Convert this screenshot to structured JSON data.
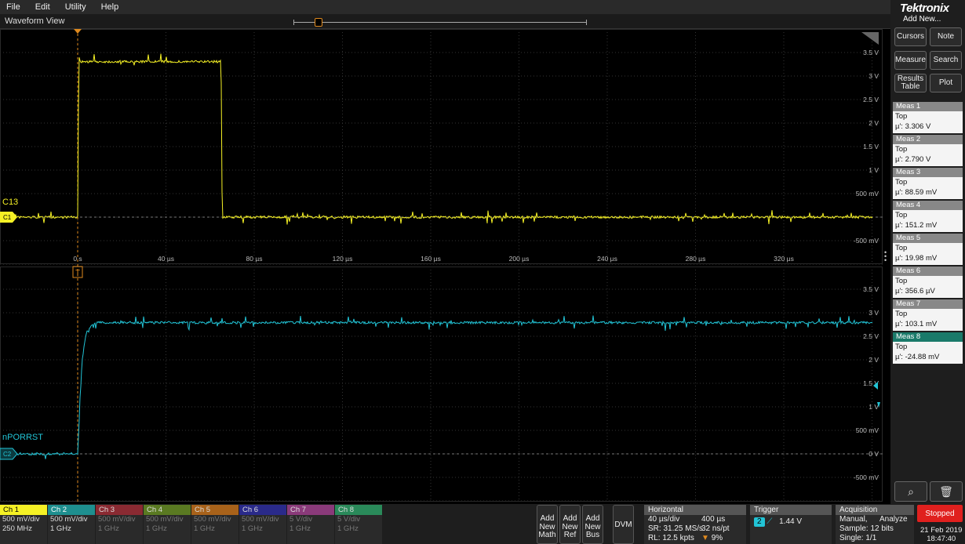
{
  "menu": [
    "File",
    "Edit",
    "Utility",
    "Help"
  ],
  "waveform_view": {
    "title": "Waveform View"
  },
  "sidebar": {
    "brand": "Tektronix",
    "add_new": "Add New...",
    "buttons": {
      "cursors": "Cursors",
      "note": "Note",
      "measure": "Measure",
      "search": "Search",
      "results_table": "Results Table",
      "plot": "Plot"
    },
    "measurements": [
      {
        "name": "Meas 1",
        "label": "Top",
        "value": "µ': 3.306 V",
        "swatch": "#f5f125",
        "num": "1"
      },
      {
        "name": "Meas 2",
        "label": "Top",
        "value": "µ': 2.790 V",
        "swatch": "#22c4d6",
        "num": "2"
      },
      {
        "name": "Meas 3",
        "label": "Top",
        "value": "µ': 88.59 mV",
        "swatch": "#d23a4a",
        "num": "3"
      },
      {
        "name": "Meas 4",
        "label": "Top",
        "value": "µ': 151.2 mV",
        "swatch": "#7ac23a",
        "num": "4"
      },
      {
        "name": "Meas 5",
        "label": "Top",
        "value": "µ': 19.98 mV",
        "swatch": "#e88a2a",
        "num": "5"
      },
      {
        "name": "Meas 6",
        "label": "Top",
        "value": "µ': 356.6 µV",
        "swatch": "#3b4fd8",
        "num": "6"
      },
      {
        "name": "Meas 7",
        "label": "Top",
        "value": "µ': 103.1 mV",
        "swatch": "#d45ac0",
        "num": "7"
      },
      {
        "name": "Meas 8",
        "label": "Top",
        "value": "µ': -24.88 mV",
        "swatch": "#2ec28a",
        "num": "8"
      }
    ]
  },
  "channels": [
    {
      "name": "Ch 1",
      "scale": "500 mV/div",
      "bw": "250 MHz",
      "color": "#f5f125",
      "active": true,
      "text": "#000"
    },
    {
      "name": "Ch 2",
      "scale": "500 mV/div",
      "bw": "1 GHz",
      "color": "#1e8f8f",
      "active": true,
      "text": "#fff"
    },
    {
      "name": "Ch 3",
      "scale": "500 mV/div",
      "bw": "1 GHz",
      "color": "#8a2a32",
      "active": false,
      "text": "#ddd"
    },
    {
      "name": "Ch 4",
      "scale": "500 mV/div",
      "bw": "1 GHz",
      "color": "#5a7a22",
      "active": false,
      "text": "#ddd"
    },
    {
      "name": "Ch 5",
      "scale": "500 mV/div",
      "bw": "1 GHz",
      "color": "#a8621a",
      "active": false,
      "text": "#ddd"
    },
    {
      "name": "Ch 6",
      "scale": "500 mV/div",
      "bw": "1 GHz",
      "color": "#2a2a8a",
      "active": false,
      "text": "#ddd"
    },
    {
      "name": "Ch 7",
      "scale": "5 V/div",
      "bw": "1 GHz",
      "color": "#8a3a7a",
      "active": false,
      "text": "#ddd"
    },
    {
      "name": "Ch 8",
      "scale": "5 V/div",
      "bw": "1 GHz",
      "color": "#2a8a5a",
      "active": false,
      "text": "#ddd"
    }
  ],
  "bottom_buttons": {
    "math": "Add New Math",
    "ref": "Add New Ref",
    "bus": "Add New Bus",
    "dvm": "DVM"
  },
  "horizontal": {
    "title": "Horizontal",
    "scale": "40 µs/div",
    "position": "400 µs",
    "sr": "SR: 31.25 MS/s",
    "pt": "32 ns/pt",
    "rl": "RL: 12.5 kpts",
    "pct": "9%"
  },
  "trigger": {
    "title": "Trigger",
    "source": "2",
    "level": "1.44 V"
  },
  "acquisition": {
    "title": "Acquisition",
    "mode": "Manual,",
    "analyze": "Analyze",
    "sample": "Sample: 12 bits",
    "single": "Single: 1/1"
  },
  "run_state": "Stopped",
  "date": "21 Feb 2019",
  "time": "18:47:40",
  "panel1": {
    "label": "C13",
    "badge": "C1",
    "color": "#f5f125",
    "y_ticks": [
      "3.5 V",
      "3 V",
      "2.5 V",
      "2 V",
      "1.5 V",
      "1 V",
      "500 mV",
      "-500 mV"
    ],
    "x_ticks": [
      "0 s",
      "40 µs",
      "80 µs",
      "120 µs",
      "160 µs",
      "200 µs",
      "240 µs",
      "280 µs",
      "320 µs"
    ]
  },
  "panel2": {
    "label": "nPORRST",
    "badge": "C2",
    "color": "#22c4d6",
    "y_ticks": [
      "3.5 V",
      "3 V",
      "2.5 V",
      "2 V",
      "1.5 V",
      "1 V",
      "500 mV",
      "0 V",
      "-500 mV"
    ]
  },
  "chart_data": [
    {
      "type": "line",
      "series": [
        {
          "name": "C13",
          "x": [
            -10,
            0,
            0.5,
            65,
            65.5,
            350
          ],
          "y": [
            0,
            0,
            3.306,
            3.306,
            0,
            0
          ]
        }
      ],
      "xlabel": "",
      "ylabel": "",
      "x_unit": "µs",
      "xlim": [
        -10,
        350
      ]
    },
    {
      "type": "line",
      "series": [
        {
          "name": "nPORRST",
          "x": [
            -10,
            0,
            2,
            4,
            8,
            350
          ],
          "y": [
            0,
            0,
            2.0,
            2.6,
            2.79,
            2.79
          ]
        }
      ],
      "xlabel": "",
      "ylabel": "",
      "x_unit": "µs",
      "xlim": [
        -10,
        350
      ]
    }
  ]
}
